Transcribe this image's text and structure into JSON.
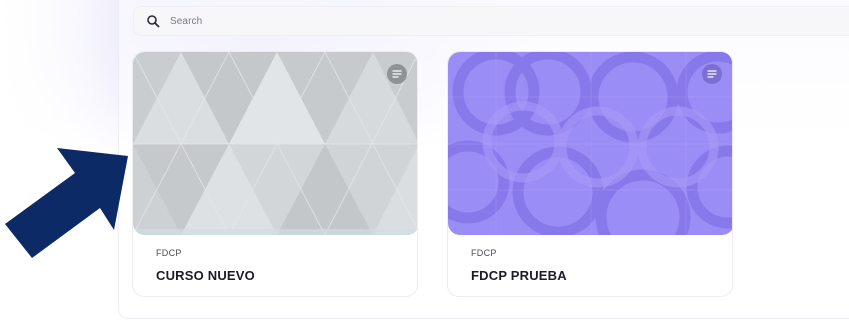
{
  "search": {
    "placeholder": "Search",
    "icon": "search-icon"
  },
  "courses": [
    {
      "subtitle": "FDCP",
      "title": "CURSO NUEVO",
      "cover_pattern": "triangles",
      "cover_color": "#d6dadc",
      "menu_icon": "options-icon"
    },
    {
      "subtitle": "FDCP",
      "title": "FDCP PRUEBA",
      "cover_pattern": "circles",
      "cover_color": "#9a8cf5",
      "menu_icon": "options-icon"
    }
  ],
  "annotation": {
    "arrow_color": "#0b2a66",
    "arrow_icon": "pointer-arrow-icon"
  }
}
